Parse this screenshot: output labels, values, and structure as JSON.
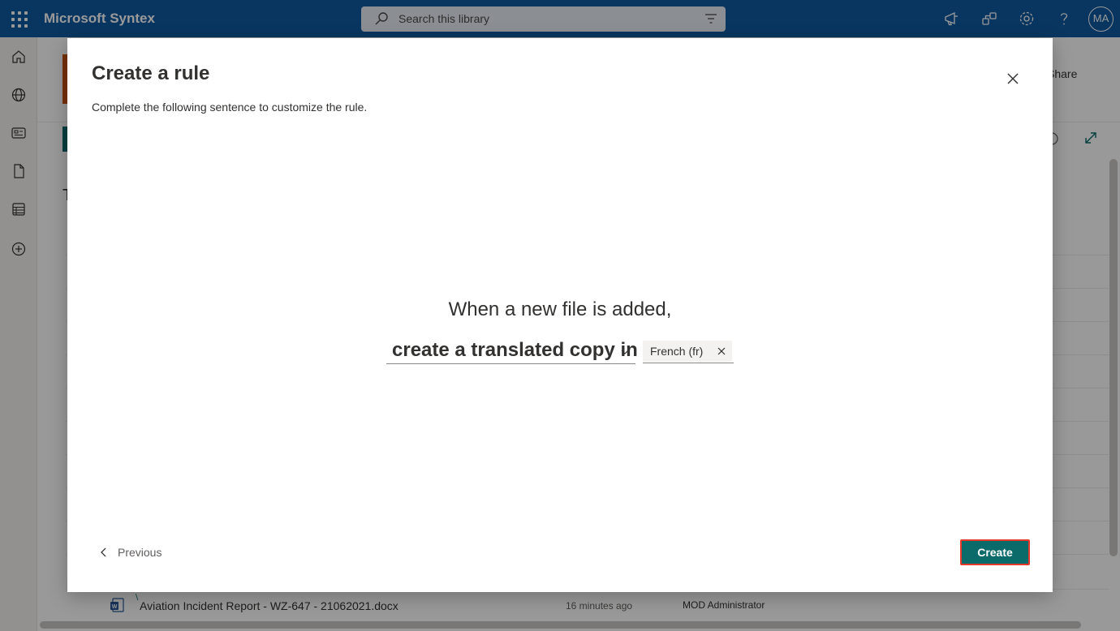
{
  "suite": {
    "app_name": "Microsoft Syntex",
    "search_placeholder": "Search this library",
    "avatar_initials": "MA"
  },
  "icons": {
    "topbar": [
      "waffle-icon",
      "search-icon",
      "filter-icon",
      "megaphone-icon",
      "share-network-icon",
      "gear-icon",
      "help-icon"
    ],
    "rail": [
      "home-icon",
      "globe-icon",
      "news-icon",
      "document-icon",
      "list-icon",
      "add-icon"
    ]
  },
  "library": {
    "share_label": "Share",
    "heading_initial": "T",
    "file_row": {
      "name": "Aviation Incident Report - WZ-647 - 21062021.docx",
      "modified": "16 minutes ago",
      "modified_by": "MOD Administrator"
    }
  },
  "dialog": {
    "title": "Create a rule",
    "subtitle": "Complete the following sentence to customize the rule.",
    "trigger_text": "When a new file is added,",
    "action_selected": "create a translated copy in",
    "language_chip": "French (fr)",
    "previous_label": "Previous",
    "create_label": "Create"
  },
  "colors": {
    "suite_bar": "#0f5aa0",
    "primary_button": "#0b6a6a",
    "highlight_border": "#e5392b",
    "site_logo": "#c94f0f"
  }
}
